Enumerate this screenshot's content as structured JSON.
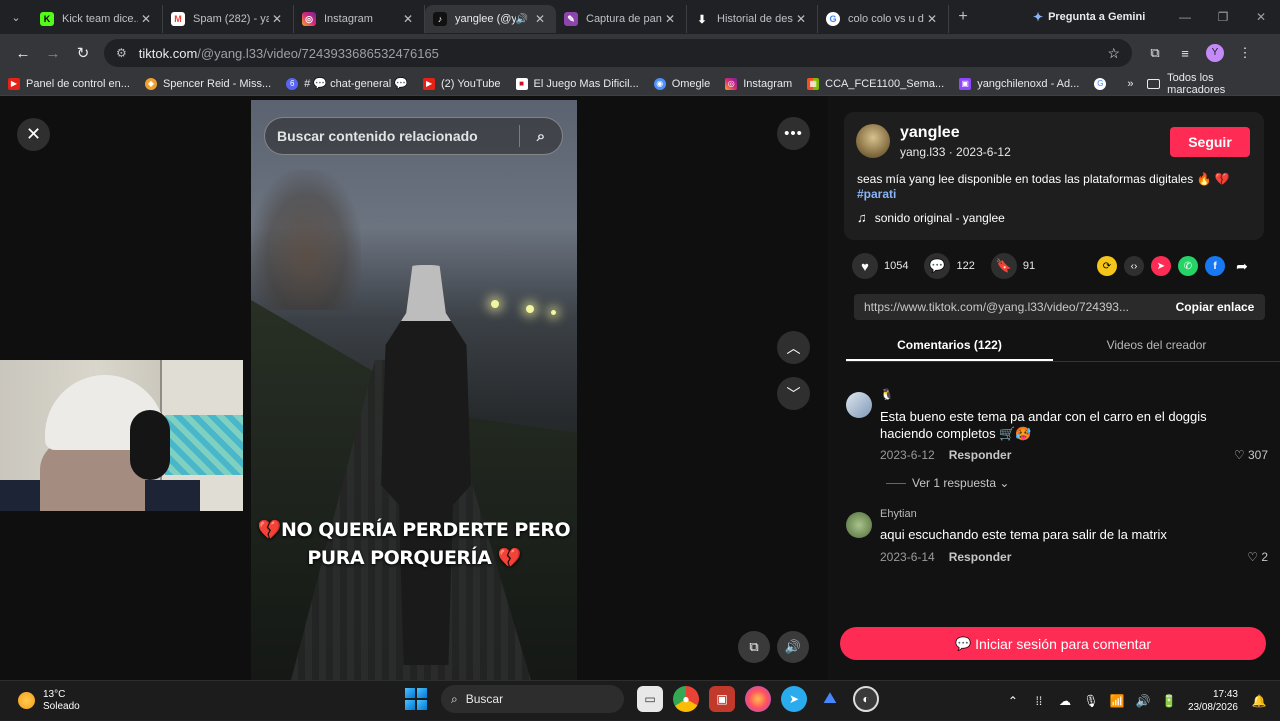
{
  "browser": {
    "tabs": [
      {
        "title": "Kick team dice...",
        "favicon": "kick-icon",
        "color": "#53fc18",
        "glyph": "K"
      },
      {
        "title": "Spam (282) - ya",
        "favicon": "gmail-icon",
        "color": "#ea4335",
        "glyph": "M"
      },
      {
        "title": "Instagram",
        "favicon": "instagram-icon",
        "color": "#d62976",
        "glyph": "◎"
      },
      {
        "title": "yanglee (@y",
        "favicon": "tiktok-icon",
        "color": "#111111",
        "glyph": "♪",
        "active": true
      },
      {
        "title": "Captura de pant",
        "favicon": "snipping-icon",
        "color": "#8e44ad",
        "glyph": "✎"
      },
      {
        "title": "Historial de des",
        "favicon": "download-icon",
        "color": "#202124",
        "glyph": "⬇"
      },
      {
        "title": "colo colo vs u d",
        "favicon": "google-icon",
        "color": "#4285f4",
        "glyph": "G"
      }
    ],
    "gemini_label": "Pregunta a Gemini",
    "address": {
      "host": "tiktok.com",
      "path": "/@yang.l33/video/7243933686532476165"
    },
    "avatar_letter": "Y",
    "bookmarks": [
      {
        "label": "Panel de control en...",
        "color": "#e62117",
        "glyph": "▶"
      },
      {
        "label": "Spencer Reid - Miss...",
        "color": "#f0a030",
        "glyph": "◆"
      },
      {
        "label": "# 💬 chat-general 💬",
        "color": "#5865f2",
        "glyph": "6"
      },
      {
        "label": "(2) YouTube",
        "color": "#e62117",
        "glyph": "▶"
      },
      {
        "label": "El Juego Mas Dificil...",
        "color": "#d01020",
        "glyph": "■"
      },
      {
        "label": "Omegle",
        "color": "#4d90fe",
        "glyph": "◉"
      },
      {
        "label": "Instagram",
        "color": "#d62976",
        "glyph": "◎"
      },
      {
        "label": "CCA_FCE1100_Sema...",
        "color": "#e8a000",
        "glyph": "▦"
      },
      {
        "label": "yangchilenoxd - Ad...",
        "color": "#9146ff",
        "glyph": "▣"
      },
      {
        "label": "",
        "color": "#4285f4",
        "glyph": "G"
      }
    ],
    "all_bookmarks_label": "Todos los marcadores"
  },
  "video": {
    "search_placeholder": "Buscar contenido relacionado",
    "caption_line1": "NO QUERÍA PERDERTE PERO",
    "caption_line2": "PURA PORQUERÍA"
  },
  "panel": {
    "author_name": "yanglee",
    "author_handle": "yang.l33",
    "post_date": "2023-6-12",
    "follow_label": "Seguir",
    "description": "seas mía yang lee disponible en todas las plataformas digitales 🔥 💔",
    "hashtag": "#parati",
    "sound": "sonido original - yanglee",
    "likes": "1054",
    "comments_count": "122",
    "saves": "91",
    "share_url": "https://www.tiktok.com/@yang.l33/video/724393...",
    "copy_label": "Copiar enlace",
    "tab_comments": "Comentarios (122)",
    "tab_creator": "Videos del creador",
    "comments": [
      {
        "user": "🐧",
        "text": "Esta bueno este tema pa andar con el carro en el doggis haciendo completos 🛒🥵",
        "date": "2023-6-12",
        "reply": "Responder",
        "likes": "307",
        "view_replies": "Ver 1 respuesta",
        "avatar_color": "#b0c4de"
      },
      {
        "user": "Ehytian",
        "text": "aqui escuchando este tema para salir de la matrix",
        "date": "2023-6-14",
        "reply": "Responder",
        "likes": "2",
        "avatar_color": "#6b8e5a"
      }
    ],
    "login_label": "Iniciar sesión para comentar"
  },
  "taskbar": {
    "temperature": "13°C",
    "weather": "Soleado",
    "search_label": "Buscar",
    "time": "17:43",
    "date": "23/08/2026"
  }
}
